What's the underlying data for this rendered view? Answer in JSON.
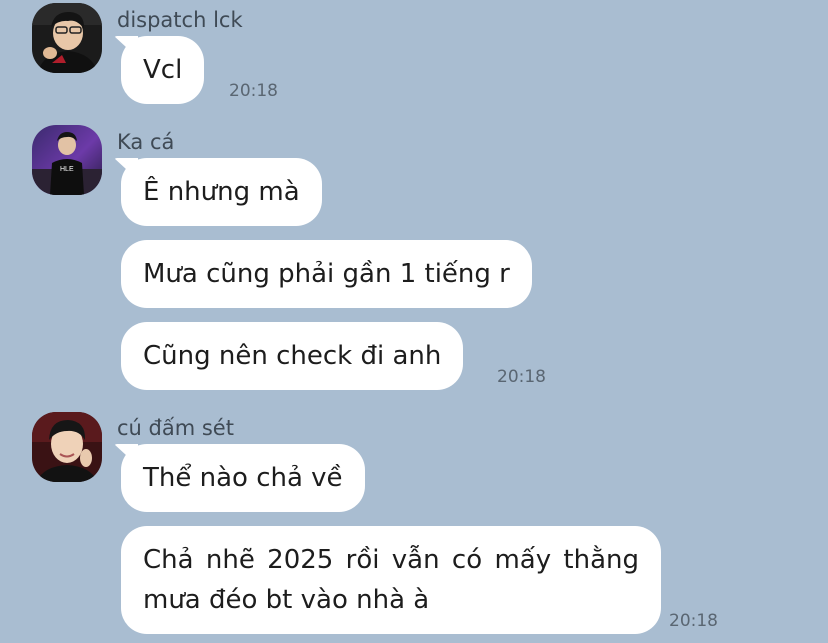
{
  "messages": [
    {
      "sender": "dispatch lck",
      "avatar": "user-avatar-photo",
      "bubbles": [
        "Vcl"
      ],
      "time": "20:18"
    },
    {
      "sender": "Ka cá",
      "avatar": "user-avatar-photo",
      "bubbles": [
        "Ê nhưng mà",
        "Mưa cũng phải gần 1 tiếng r",
        "Cũng nên check đi anh"
      ],
      "time": "20:18"
    },
    {
      "sender": "cú đấm sét",
      "avatar": "user-avatar-photo",
      "bubbles": [
        "Thể nào chả về",
        "Chả nhẽ 2025 rồi vẫn có mấy thằng mưa đéo bt vào nhà à"
      ],
      "time": "20:18"
    }
  ],
  "colors": {
    "background": "#a9bdd1",
    "bubble": "#ffffff",
    "sender_text": "#3f4a55",
    "timestamp_text": "#5a6672"
  }
}
